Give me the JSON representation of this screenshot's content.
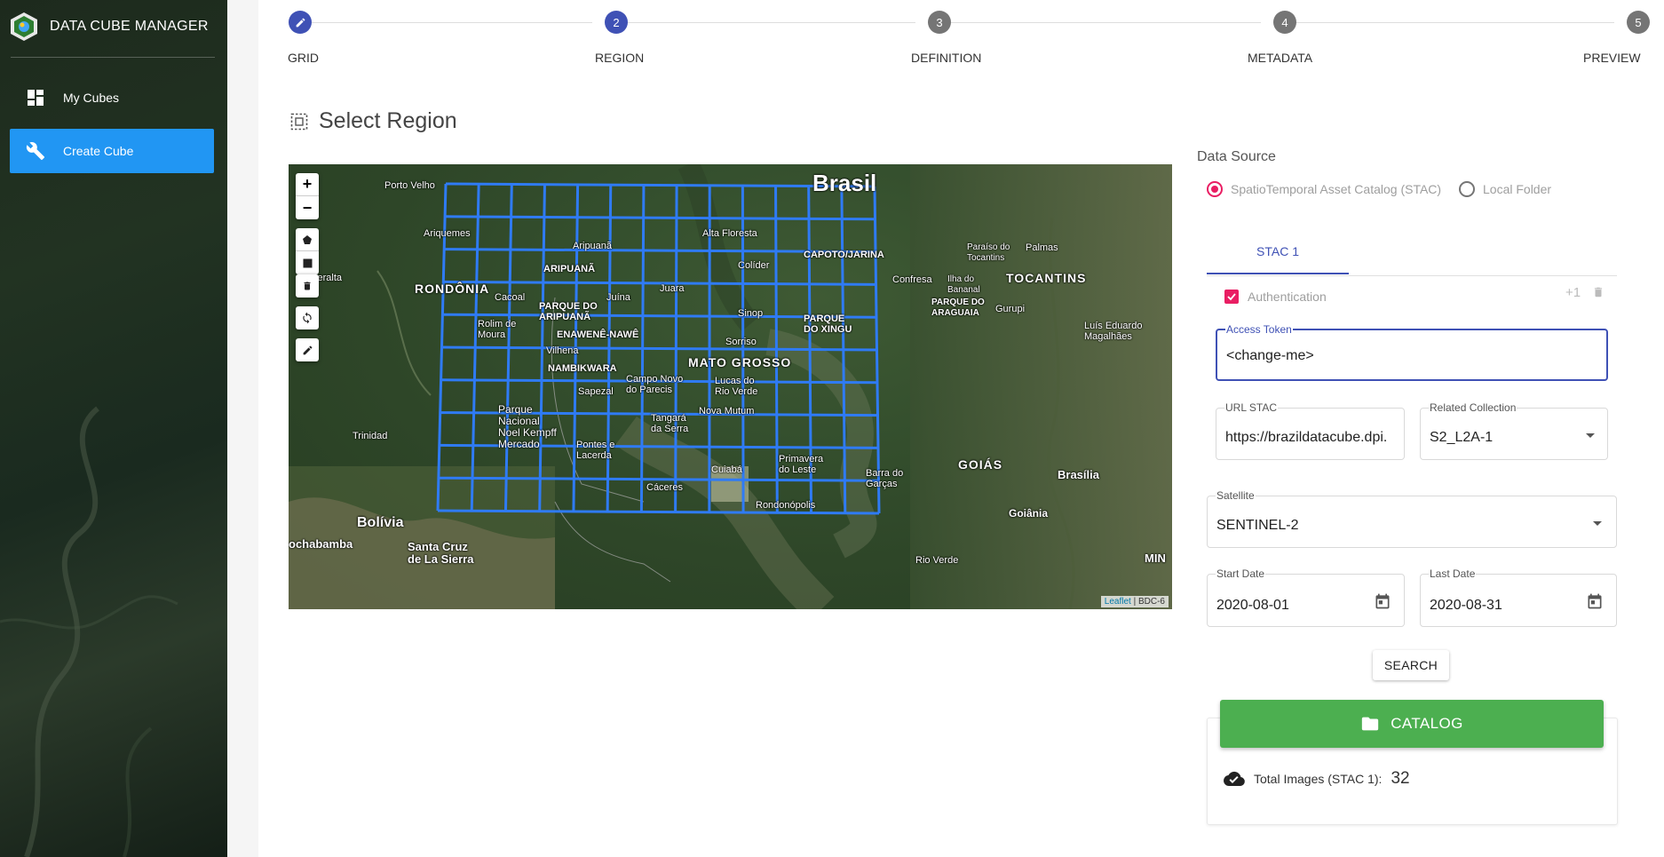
{
  "app": {
    "title": "DATA CUBE MANAGER"
  },
  "sidebar": {
    "items": [
      {
        "label": "My Cubes",
        "icon": "dashboard-icon"
      },
      {
        "label": "Create Cube",
        "icon": "wrench-icon",
        "active": true
      }
    ]
  },
  "stepper": {
    "steps": [
      {
        "number": "",
        "label": "GRID",
        "icon": "pencil-icon",
        "state": "done"
      },
      {
        "number": "2",
        "label": "REGION",
        "state": "active"
      },
      {
        "number": "3",
        "label": "DEFINITION",
        "state": "inactive"
      },
      {
        "number": "4",
        "label": "METADATA",
        "state": "inactive"
      },
      {
        "number": "5",
        "label": "PREVIEW",
        "state": "inactive"
      }
    ]
  },
  "page": {
    "title": "Select Region"
  },
  "map": {
    "zoom_in": "+",
    "zoom_out": "−",
    "labels": {
      "brasil": "Brasil",
      "bolivia": "Bolívia",
      "rondonia": "RONDÔNIA",
      "mato_grosso": "MATO GROSSO",
      "tocantins": "TOCANTINS",
      "goias": "GOIÁS",
      "porto_velho": "Porto Velho",
      "ariquemes": "Ariquemes",
      "riberalta": "Riberalta",
      "trinidad": "Trinidad",
      "cochabamba": "ochabamba",
      "santa_cruz": "Santa Cruz\nde La Sierra",
      "brasilia": "Brasília",
      "goiania": "Goiânia",
      "palmas": "Palmas",
      "cuiaba": "Cuiabá",
      "aripuana": "Aripuanã",
      "sinop": "Sinop",
      "sorriso": "Sorriso",
      "capoto": "CAPOTO/JARINA",
      "xingu": "PARQUE\nDO XINGU",
      "nambikwara": "NAMBIKWARA",
      "enawene": "ENAWENÊ-NAWÊ",
      "caceres": "Cáceres",
      "rondonopolis": "Rondonópolis",
      "rio_verde": "Rio Verde",
      "barra_garcas": "Barra do\nGarças",
      "primavera": "Primavera\ndo Leste",
      "luis_eduardo": "Luís Eduardo\nMagalhães",
      "gurupi": "Gurupi",
      "juina": "Juína",
      "juara": "Juara",
      "vilhena": "Vilhena",
      "cacoal": "Cacoal",
      "rolim": "Rolim de\nMoura",
      "confresa": "Confresa",
      "alta_floresta": "Alta Floresta",
      "lucas": "Lucas do\nRio Verde",
      "nova_mutum": "Nova Mutum",
      "tangara": "Tangará\nda Serra",
      "pontes": "Pontes e\nLacerda",
      "campo_novo": "Campo Novo\ndo Parecis",
      "sapezal": "Sapezal",
      "parque_noel": "Parque\nNacional\nNoel Kempff\nMercado",
      "parque_aripuana": "PARQUE DO\nARIPUANÃ",
      "aripuana_ti": "ARIPUANÃ",
      "paraiso": "Paraíso do\nTocantins",
      "ilha": "Ilha do\nBananal",
      "parque_araguaia": "PARQUE DO\nARAGUAIA",
      "min": "MIN",
      "colider": "Colíder"
    },
    "attribution_link": "Leaflet",
    "attribution_text": " | BDC-6"
  },
  "data_source": {
    "label": "Data Source",
    "options": [
      {
        "label": "SpatioTemporal Asset Catalog (STAC)",
        "checked": true
      },
      {
        "label": "Local Folder",
        "checked": false
      }
    ]
  },
  "stac": {
    "tab_label": "STAC 1",
    "authentication_label": "Authentication",
    "add_label": "+1",
    "access_token_label": "Access Token",
    "access_token_value": "<change-me>",
    "url_label": "URL STAC",
    "url_value": "https://brazildatacube.dpi.",
    "collection_label": "Related Collection",
    "collection_value": "S2_L2A-1"
  },
  "satellite": {
    "label": "Satellite",
    "value": "SENTINEL-2"
  },
  "dates": {
    "start_label": "Start Date",
    "start_value": "2020-08-01",
    "last_label": "Last Date",
    "last_value": "2020-08-31"
  },
  "actions": {
    "search_label": "SEARCH",
    "catalog_label": "CATALOG"
  },
  "totals": {
    "label": "Total Images (STAC 1):",
    "value": "32"
  },
  "colors": {
    "primary": "#3f51b5",
    "accent": "#e91e63",
    "nav_active": "#2196f3",
    "catalog": "#4caf50",
    "grid": "#2f7bf5"
  }
}
